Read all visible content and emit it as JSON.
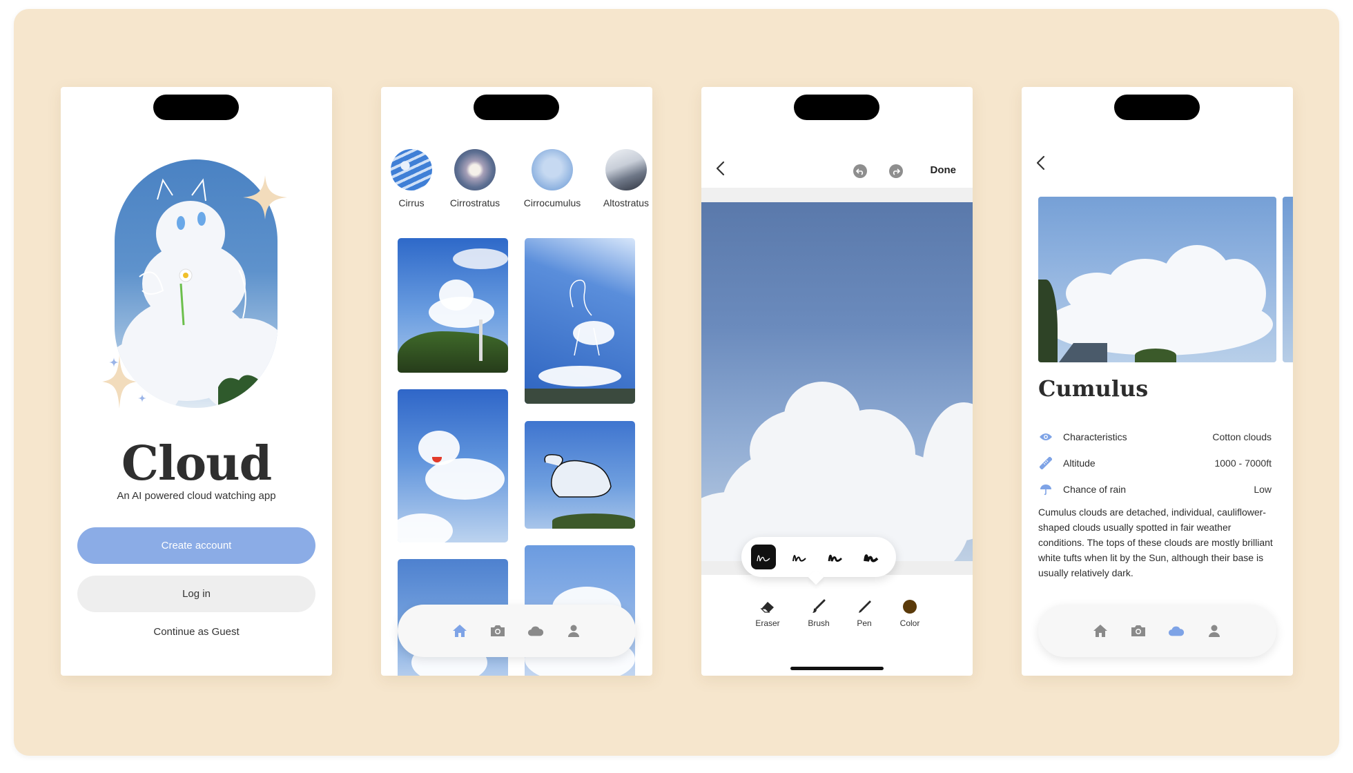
{
  "theme": {
    "background": "#f6e6cd",
    "accent": "#8bace6",
    "inactive_icon": "#8a8a8a"
  },
  "screen1": {
    "title": "Cloud",
    "subtitle": "An AI powered cloud watching app",
    "create_account_label": "Create account",
    "login_label": "Log in",
    "guest_label": "Continue as Guest"
  },
  "screen2": {
    "cloud_types": [
      {
        "label": "Cirrus"
      },
      {
        "label": "Cirrostratus"
      },
      {
        "label": "Cirrocumulus"
      },
      {
        "label": "Altostratus"
      }
    ],
    "nav": [
      {
        "icon": "home-icon",
        "active": true
      },
      {
        "icon": "camera-icon",
        "active": false
      },
      {
        "icon": "cloud-icon",
        "active": false
      },
      {
        "icon": "user-icon",
        "active": false
      }
    ]
  },
  "screen3": {
    "done_label": "Done",
    "tools": [
      {
        "label": "Eraser",
        "icon": "eraser-icon"
      },
      {
        "label": "Brush",
        "icon": "brush-icon"
      },
      {
        "label": "Pen",
        "icon": "pen-icon"
      },
      {
        "label": "Color",
        "icon": "color-swatch-icon",
        "color": "#5a3a0a"
      }
    ]
  },
  "screen4": {
    "title": "Cumulus",
    "attributes": [
      {
        "name": "Characteristics",
        "value": "Cotton clouds",
        "icon": "eye-icon"
      },
      {
        "name": "Altitude",
        "value": "1000 - 7000ft",
        "icon": "ruler-icon"
      },
      {
        "name": "Chance of rain",
        "value": "Low",
        "icon": "umbrella-icon"
      }
    ],
    "description": "Cumulus clouds are detached, individual, cauliflower-shaped clouds usually spotted in fair weather conditions. The tops of these clouds are mostly brilliant white tufts when lit by the Sun, although their base is usually relatively dark."
  }
}
